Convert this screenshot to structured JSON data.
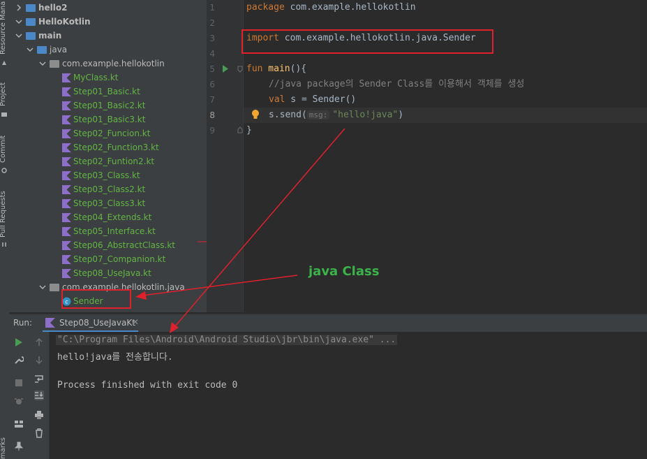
{
  "tool_strip": {
    "resource_manager": "Resource Mana",
    "project": "Project",
    "commit": "Commit",
    "pull_requests": "Pull Requests",
    "bookmarks": "marks"
  },
  "project_tree": {
    "rows": [
      {
        "label": "hello2",
        "depth": 0,
        "kind": "module",
        "expanded": false
      },
      {
        "label": "HelloKotlin",
        "depth": 0,
        "kind": "module",
        "expanded": true
      },
      {
        "label": "main",
        "depth": 1,
        "kind": "folder",
        "expanded": true
      },
      {
        "label": "java",
        "depth": 2,
        "kind": "source",
        "expanded": true
      },
      {
        "label": "com.example.hellokotlin",
        "depth": 3,
        "kind": "package",
        "expanded": true
      },
      {
        "label": "MyClass.kt",
        "depth": 4,
        "kind": "kt"
      },
      {
        "label": "Step01_Basic.kt",
        "depth": 4,
        "kind": "kt"
      },
      {
        "label": "Step01_Basic2.kt",
        "depth": 4,
        "kind": "kt"
      },
      {
        "label": "Step01_Basic3.kt",
        "depth": 4,
        "kind": "kt"
      },
      {
        "label": "Step02_Funcion.kt",
        "depth": 4,
        "kind": "kt"
      },
      {
        "label": "Step02_Function3.kt",
        "depth": 4,
        "kind": "kt"
      },
      {
        "label": "Step02_Funtion2.kt",
        "depth": 4,
        "kind": "kt"
      },
      {
        "label": "Step03_Class.kt",
        "depth": 4,
        "kind": "kt"
      },
      {
        "label": "Step03_Class2.kt",
        "depth": 4,
        "kind": "kt"
      },
      {
        "label": "Step03_Class3.kt",
        "depth": 4,
        "kind": "kt"
      },
      {
        "label": "Step04_Extends.kt",
        "depth": 4,
        "kind": "kt"
      },
      {
        "label": "Step05_Interface.kt",
        "depth": 4,
        "kind": "kt"
      },
      {
        "label": "Step06_AbstractClass.kt",
        "depth": 4,
        "kind": "kt"
      },
      {
        "label": "Step07_Companion.kt",
        "depth": 4,
        "kind": "kt"
      },
      {
        "label": "Step08_UseJava.kt",
        "depth": 4,
        "kind": "kt"
      },
      {
        "label": "com.example.hellokotlin.java",
        "depth": 3,
        "kind": "package",
        "expanded": true
      },
      {
        "label": "Sender",
        "depth": 4,
        "kind": "java-class"
      }
    ]
  },
  "editor": {
    "line_numbers": [
      "1",
      "2",
      "3",
      "4",
      "5",
      "6",
      "7",
      "8",
      "9"
    ],
    "line1_kw": "package",
    "line1_rest": " com.example.hellokotlin",
    "line3_kw": "import",
    "line3_rest": " com.example.hellokotlin.java.Sender",
    "line5_kw": "fun",
    "line5_fn": " main",
    "line5_rest": "(){",
    "line6_comment": "//java package의 Sender Class를 이용해서 객체를 생성",
    "line7_kw": "val",
    "line7_rest": " s = Sender()",
    "line8_call": "s.send(",
    "line8_hint": "msg:",
    "line8_str": "\"hello!java\"",
    "line8_close": ")",
    "line9": "}"
  },
  "run": {
    "label": "Run:",
    "tab": "Step08_UseJavaKt",
    "console": [
      "\"C:\\Program Files\\Android\\Android Studio\\jbr\\bin\\java.exe\" ...",
      "hello!java를 전송합니다.",
      "",
      "Process finished with exit code 0"
    ]
  },
  "annotation": {
    "label": "java Class"
  },
  "colors": {
    "accent_red": "#e0202a",
    "annotation_green": "#3cb34a",
    "tree_green": "#62b543",
    "keyword": "#cc7832",
    "string": "#6a8759"
  }
}
